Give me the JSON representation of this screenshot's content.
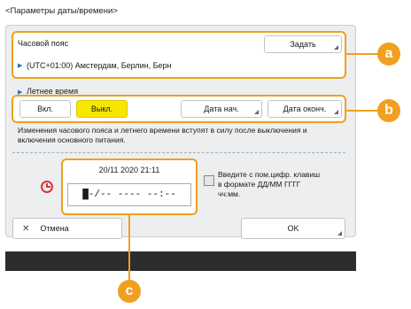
{
  "header": {
    "title": "<Параметры даты/времени>"
  },
  "timezone": {
    "label": "Часовой пояс",
    "value": "(UTC+01:00) Амстердам, Берлин, Берн",
    "set_button": "Задать"
  },
  "dst": {
    "label": "Летнее время",
    "on": "Вкл.",
    "off": "Выкл.",
    "start_date": "Дата нач.",
    "end_date": "Дата оконч."
  },
  "notice": "Изменения часового пояса и летнего времени вступят в силу после выключения и включения основного питания.",
  "datetime": {
    "current": "20/11 2020 21:11",
    "input": "█-/-- ---- --:--"
  },
  "hint": "Введите с пом.цифр. клавиш в формате ДД/ММ ГГГГ чч:мм.",
  "footer": {
    "cancel": "Отмена",
    "ok": "OK"
  },
  "callouts": [
    "a",
    "b",
    "c"
  ],
  "colors": {
    "accent_yellow": "#f6e600",
    "callout": "#f0a01e",
    "link_blue": "#1e74c8"
  }
}
